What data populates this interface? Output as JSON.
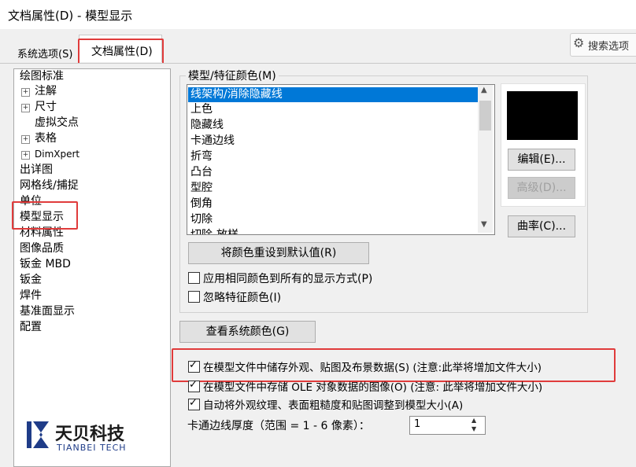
{
  "window": {
    "title": "文档属性(D) - 模型显示"
  },
  "tabs": {
    "system_options": "系统选项(S)",
    "document_properties": "文档属性(D)"
  },
  "search": {
    "label": "搜索选项"
  },
  "tree": {
    "items": [
      "绘图标准",
      "注解",
      "尺寸",
      "虚拟交点",
      "表格",
      "DimXpert",
      "出详图",
      "网格线/捕捉",
      "单位",
      "模型显示",
      "材料属性",
      "图像品质",
      "钣金 MBD",
      "钣金",
      "焊件",
      "基准面显示",
      "配置"
    ]
  },
  "model_colors": {
    "group_label": "模型/特征颜色(M)",
    "list": [
      "线架构/消除隐藏线",
      "上色",
      "隐藏线",
      "卡通边线",
      "折弯",
      "凸台",
      "型腔",
      "倒角",
      "切除",
      "切除-放样"
    ],
    "selected_index": 0,
    "edit_button": "编辑(E)...",
    "advanced_button": "高级(D)...",
    "curvature_button": "曲率(C)...",
    "reset_button": "将颜色重设到默认值(R)",
    "apply_same_color": {
      "label": "应用相同颜色到所有的显示方式(P)",
      "checked": false
    },
    "ignore_feature_color": {
      "label": "忽略特征颜色(I)",
      "checked": false
    },
    "preview_color": "#000000"
  },
  "view_system_colors_button": "查看系统颜色(G)",
  "options": {
    "store_appearance": {
      "label": "在模型文件中储存外观、贴图及布景数据(S) (注意:此举将增加文件大小)",
      "checked": true
    },
    "store_ole": {
      "label": "在模型文件中存储 OLE 对象数据的图像(O) (注意: 此举将增加文件大小)",
      "checked": true
    },
    "auto_scale": {
      "label": "自动将外观纹理、表面粗糙度和贴图调整到模型大小(A)",
      "checked": true
    }
  },
  "silhouette": {
    "label": "卡通边线厚度（范围 = 1 - 6 像素）：",
    "value": "1"
  },
  "watermark": {
    "company": "天贝科技",
    "company_en": "TIANBEI TECH"
  },
  "colors": {
    "highlight": "#e03b3b",
    "selection": "#0078d7",
    "logo": "#1f3c88"
  }
}
